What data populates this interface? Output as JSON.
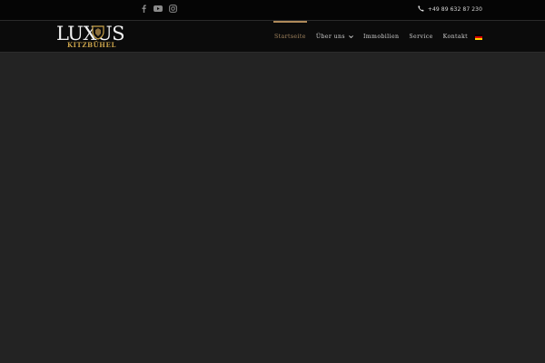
{
  "topbar": {
    "social_icons": [
      "facebook-icon",
      "youtube-icon",
      "instagram-icon"
    ],
    "phone": "+49 89 632 87 230"
  },
  "logo": {
    "wordmark": "LUXUS",
    "subtitle": "KITZBÜHEL"
  },
  "nav": {
    "items": [
      {
        "label": "Startseite",
        "active": true
      },
      {
        "label": "Über uns",
        "has_dropdown": true
      },
      {
        "label": "Immobilien"
      },
      {
        "label": "Service"
      },
      {
        "label": "Kontakt"
      }
    ],
    "language": "de-flag-icon"
  },
  "colors": {
    "accent": "#b08a5a",
    "topbar_bg": "#050505",
    "header_bg": "#0b0b0b",
    "page_bg": "#232323"
  }
}
